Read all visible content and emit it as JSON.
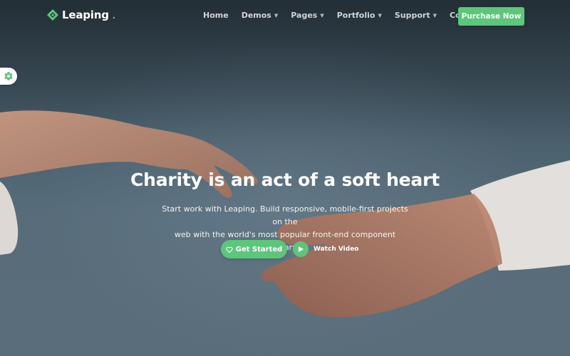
{
  "brand": {
    "name": "Leaping",
    "dot": ".",
    "accent": "#5cc67a"
  },
  "nav": {
    "items": [
      {
        "label": "Home",
        "dropdown": false
      },
      {
        "label": "Demos",
        "dropdown": true
      },
      {
        "label": "Pages",
        "dropdown": true
      },
      {
        "label": "Portfolio",
        "dropdown": true
      },
      {
        "label": "Support",
        "dropdown": true
      },
      {
        "label": "Contact",
        "dropdown": false
      }
    ],
    "purchase_label": "Purchase Now"
  },
  "settings": {
    "icon": "gear-icon"
  },
  "hero": {
    "title": "Charity is an act of a soft heart",
    "subtitle_line1": "Start work with Leaping. Build responsive, mobile-first projects on the",
    "subtitle_line2": "web with the world's most popular front-end component library.",
    "primary_cta": "Get Started",
    "primary_cta_icon": "heart-icon",
    "secondary_cta": "Watch Video",
    "secondary_cta_icon": "play-icon"
  }
}
